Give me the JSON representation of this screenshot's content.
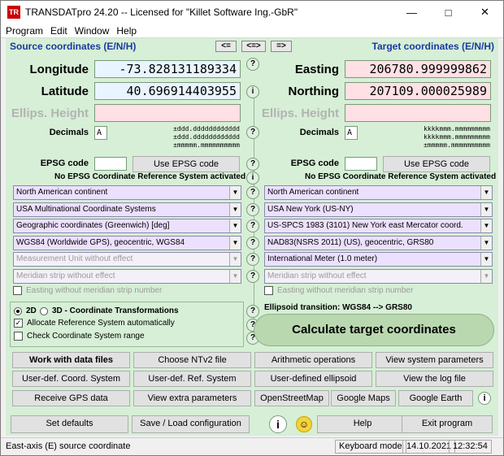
{
  "window": {
    "title": "TRANSDATpro 24.20 -- Licensed for \"Killet Software Ing.-GbR\"",
    "icon_text": "TR"
  },
  "menu": [
    "Program",
    "Edit",
    "Window",
    "Help"
  ],
  "nav": {
    "left": "<=",
    "both": "<=>",
    "right": "=>"
  },
  "source": {
    "header": "Source coordinates (E/N/H)",
    "longitude_label": "Longitude",
    "longitude_value": "-73.828131189334",
    "latitude_label": "Latitude",
    "latitude_value": "40.696914403955",
    "height_label": "Ellips. Height",
    "height_value": "",
    "decimals_label": "Decimals",
    "decimals_value": "A",
    "format_lines": [
      "±ddd.dddddddddddd",
      "±ddd.dddddddddddd",
      "±mmmmm.mmmmmmmmmm"
    ],
    "epsg_label": "EPSG code",
    "epsg_value": "",
    "epsg_button": "Use EPSG code",
    "epsg_note": "No EPSG Coordinate Reference System activated",
    "selects": [
      "North American continent",
      "USA Multinational Coordinate Systems",
      "Geographic coordinates (Greenwich) [deg]",
      "WGS84 (Worldwide GPS), geocentric, WGS84",
      "Measurement Unit without effect",
      "Meridian strip without effect"
    ],
    "easting_meridian": "Easting without meridian strip number"
  },
  "target": {
    "header": "Target coordinates (E/N/H)",
    "easting_label": "Easting",
    "easting_value": "206780.999999862",
    "northing_label": "Northing",
    "northing_value": "207109.000025989",
    "height_label": "Ellips. Height",
    "height_value": "",
    "decimals_label": "Decimals",
    "decimals_value": "A",
    "format_lines": [
      "kkkkmmm.mmmmmmmmm",
      "kkkkmmm.mmmmmmmmm",
      "±mmmmm.mmmmmmmmmm"
    ],
    "epsg_label": "EPSG code",
    "epsg_value": "",
    "epsg_button": "Use EPSG code",
    "epsg_note": "No EPSG Coordinate Reference System activated",
    "selects": [
      "North American continent",
      "USA New York (US-NY)",
      "US-SPCS 1983 (3101) New York east Mercator coord.",
      "NAD83(NSRS 2011) (US), geocentric, GRS80",
      "International Meter (1.0 meter)",
      "Meridian strip without effect"
    ],
    "easting_meridian": "Easting without meridian strip number"
  },
  "options": {
    "mode_2d": "2D",
    "mode_3d": "3D - Coordinate Transformations",
    "allocate": "Allocate Reference System automatically",
    "check_range": "Check Coordinate System range",
    "ellipsoid_transition": "Ellipsoid transition: WGS84 --> GRS80",
    "calculate": "Calculate target coordinates"
  },
  "buttons": {
    "row1": [
      "Work with data files",
      "Choose NTv2 file",
      "Arithmetic operations",
      "View system parameters"
    ],
    "row2": [
      "User-def. Coord. System",
      "User-def. Ref. System",
      "User-defined ellipsoid",
      "View the log file"
    ],
    "row3": [
      "Receive GPS data",
      "View extra parameters",
      "OpenStreetMap",
      "Google Maps",
      "Google Earth"
    ],
    "row4": [
      "Set defaults",
      "Save / Load configuration",
      "Help",
      "Exit program"
    ]
  },
  "status": {
    "text": "East-axis (E) source coordinate",
    "mode": "Keyboard mode",
    "date": "14.10.2021",
    "time": "12:32:54"
  },
  "colors": {
    "header_blue": "#1a3aa0",
    "panel_green": "#d6efd6",
    "source_field": "#e8f4ff",
    "target_field": "#ffe0e4",
    "select_purple": "#ece0ff"
  }
}
